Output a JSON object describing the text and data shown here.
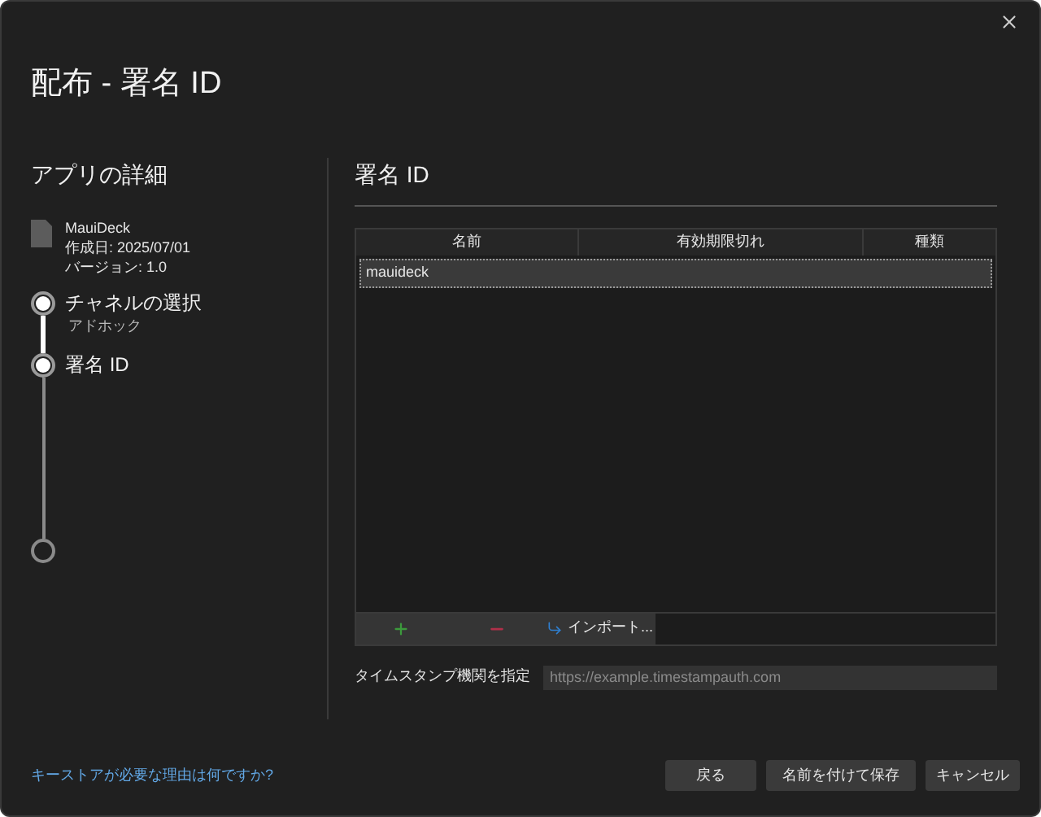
{
  "window": {
    "title": "配布 - 署名 ID"
  },
  "sidebar": {
    "title": "アプリの詳細",
    "app": {
      "name": "MauiDeck",
      "created": "作成日: 2025/07/01",
      "version": "バージョン: 1.0"
    },
    "steps": [
      {
        "label": "チャネルの選択",
        "sublabel": "アドホック",
        "kind": "done"
      },
      {
        "label": "署名 ID",
        "kind": "current"
      },
      {
        "kind": "pending"
      }
    ]
  },
  "main": {
    "title": "署名 ID",
    "table": {
      "columns": [
        "名前",
        "有効期限切れ",
        "種類"
      ],
      "rows": [
        {
          "cells": [
            "mauideck",
            "",
            ""
          ],
          "selected": true
        }
      ]
    },
    "toolbar": {
      "import_label": "インポート..."
    },
    "timestamp": {
      "label": "タイムスタンプ機関を指定",
      "placeholder": "https://example.timestampauth.com"
    }
  },
  "footer": {
    "link": "キーストアが必要な理由は何ですか?",
    "buttons": [
      "戻る",
      "名前を付けて保存",
      "キャンセル"
    ]
  }
}
